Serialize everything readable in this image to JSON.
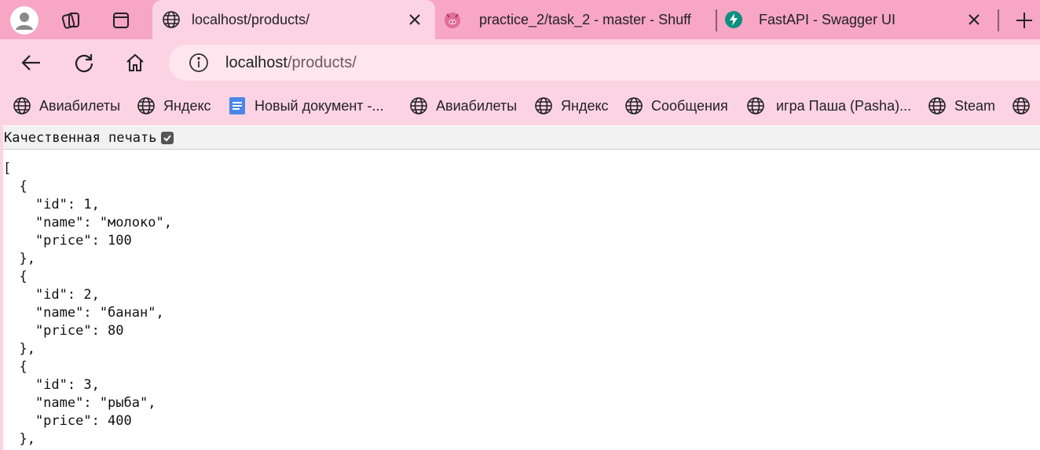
{
  "browser": {
    "tabs": [
      {
        "title": "localhost/products/",
        "favicon": "globe-icon",
        "active": true
      },
      {
        "title": "practice_2/task_2 - master - Shuff",
        "favicon": "shuffle-pig-icon",
        "active": false
      },
      {
        "title": "FastAPI - Swagger UI",
        "favicon": "fastapi-icon",
        "active": false
      }
    ],
    "address": {
      "host": "localhost",
      "path": "/products/"
    },
    "bookmarks": [
      {
        "label": "Авиабилеты",
        "icon": "globe-icon"
      },
      {
        "label": "Яндекс",
        "icon": "globe-icon"
      },
      {
        "label": "Новый документ -...",
        "icon": "docs-icon"
      },
      {
        "label": "Авиабилеты",
        "icon": "globe-icon"
      },
      {
        "label": "Яндекс",
        "icon": "globe-icon"
      },
      {
        "label": "Сообщения",
        "icon": "globe-icon"
      },
      {
        "label": "игра Паша (Pasha)...",
        "icon": "globe-icon"
      },
      {
        "label": "Steam",
        "icon": "globe-icon"
      },
      {
        "label": "",
        "icon": "globe-icon"
      }
    ],
    "colors": {
      "tabstrip": "#f7a6c4",
      "toolbar": "#fcd3e2",
      "omnibox": "#ffe6ee"
    }
  },
  "page": {
    "pretty_print_label": "Качественная печать",
    "pretty_print_checked": true,
    "json_text": "[\n  {\n    \"id\": 1,\n    \"name\": \"молоко\",\n    \"price\": 100\n  },\n  {\n    \"id\": 2,\n    \"name\": \"банан\",\n    \"price\": 80\n  },\n  {\n    \"id\": 3,\n    \"name\": \"рыба\",\n    \"price\": 400\n  },"
  }
}
